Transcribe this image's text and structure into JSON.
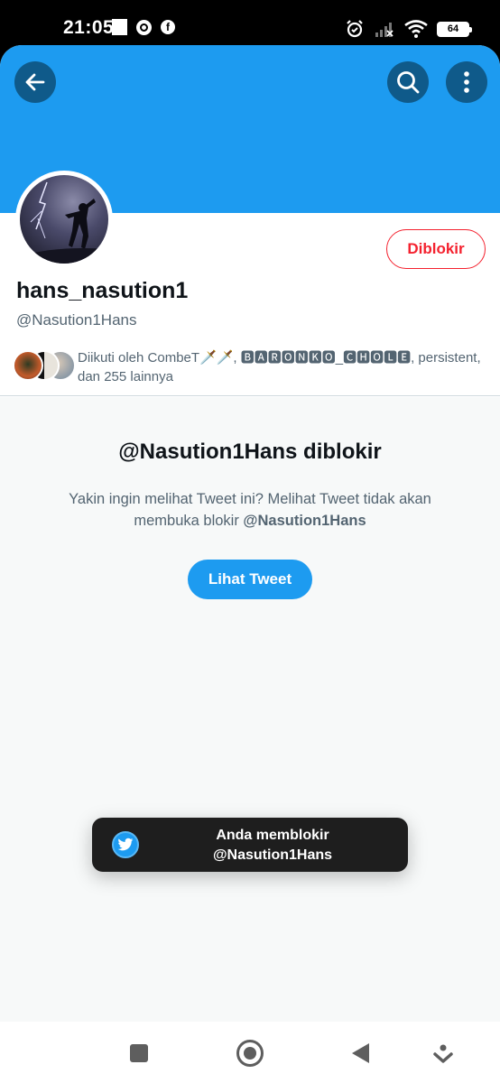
{
  "status_bar": {
    "time": "21:05",
    "battery": "64"
  },
  "header": {
    "back_icon": "arrow-left-icon",
    "search_icon": "search-icon",
    "more_icon": "more-vertical-icon",
    "banner_color": "#1d9bf0"
  },
  "profile": {
    "display_name": "hans_nasution1",
    "handle": "@Nasution1Hans",
    "blocked_button_label": "Diblokir",
    "followers_text": "Diikuti oleh CombeT🗡️🗡️, 🅱🅰🆁🅾🅽🅺🅾_🅲🅷🅾🅻🅴, persistent, dan 255 lainnya"
  },
  "blocked": {
    "title": "@Nasution1Hans diblokir",
    "description": "Yakin ingin melihat Tweet ini? Melihat Tweet tidak akan membuka blokir",
    "description_handle": "@Nasution1Hans",
    "view_button_label": "Lihat Tweet"
  },
  "toast": {
    "line1": "Anda memblokir",
    "line2": "@Nasution1Hans",
    "icon": "twitter-bird-icon"
  },
  "colors": {
    "accent": "#1d9bf0",
    "blocked_red": "#f4212e",
    "text_primary": "#0f1419",
    "text_secondary": "#536471"
  }
}
